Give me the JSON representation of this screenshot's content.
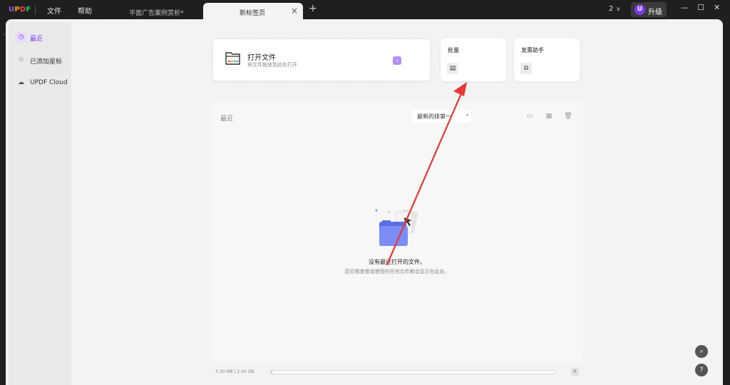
{
  "app": {
    "logo": "UPDF"
  },
  "menu": [
    {
      "label": "文件"
    },
    {
      "label": "帮助"
    }
  ],
  "tabs": [
    {
      "label": "平面广告案例赏析*",
      "active": false
    },
    {
      "label": "新标签页",
      "active": true
    }
  ],
  "tab_close": "×",
  "tab_add": "+",
  "account": {
    "count": "2",
    "chevron": "∨",
    "avatar_letter": "U",
    "upgrade_label": "升级"
  },
  "window_controls": [
    "—",
    "☐",
    "✕"
  ],
  "sidebar": {
    "items": [
      {
        "label": "最近",
        "icon": "clock-icon",
        "active": true
      },
      {
        "label": "已添加星标",
        "icon": "star-icon",
        "active": false
      },
      {
        "label": "UPDF Cloud",
        "icon": "cloud-icon",
        "active": false
      }
    ]
  },
  "open_card": {
    "title": "打开文件",
    "subtitle": "将文件拖放到此处打开",
    "arrow": "›"
  },
  "batch_card": {
    "title": "批量",
    "icon": "document-stack-icon"
  },
  "invoice_card": {
    "title": "发票助手",
    "icon": "invoice-icon"
  },
  "recent": {
    "title": "最近",
    "sort_label": "最新的排第一",
    "empty_title": "没有最近打开的文件。",
    "empty_subtitle": "您近期查看或使用的任何文件都会显示在此处。"
  },
  "storage": {
    "text": "3.30 MB | 2.00 GB",
    "used_fraction": 0.0016,
    "add": "+"
  },
  "fabs": [
    {
      "icon": "search-icon",
      "glyph": "⌕"
    },
    {
      "icon": "help-icon",
      "glyph": "?"
    }
  ],
  "colors": {
    "accent": "#7c3aed",
    "annotation": "#e53935"
  }
}
